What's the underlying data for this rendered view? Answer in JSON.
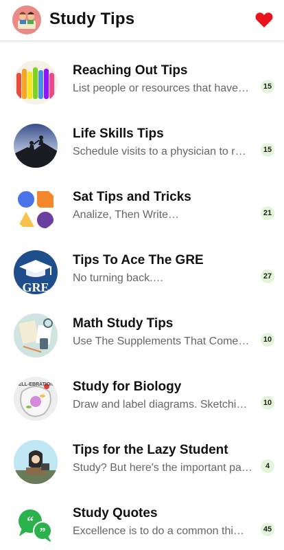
{
  "app": {
    "title": "Study Tips",
    "logo_icon": "kids-reading-icon",
    "favorite_icon": "heart-icon",
    "heart_color": "#e8131b"
  },
  "colors": {
    "badge_bg": "#e2f5d8",
    "subtitle": "#666666"
  },
  "items": [
    {
      "title": "Reaching Out Tips",
      "subtitle": "List people or resources that have…",
      "count": "15",
      "icon": "raised-hands-icon"
    },
    {
      "title": "Life Skills Tips",
      "subtitle": "Schedule visits to a physician to r…",
      "count": "15",
      "icon": "mountain-climbers-icon"
    },
    {
      "title": "Sat Tips and Tricks",
      "subtitle": "Analize, Then Write…",
      "count": "21",
      "icon": "colorful-shapes-icon"
    },
    {
      "title": "Tips To Ace The GRE",
      "subtitle": "No turning back.…",
      "count": "27",
      "icon": "gre-graduation-cap-icon"
    },
    {
      "title": "Math Study Tips",
      "subtitle": "Use The Supplements That Come…",
      "count": "10",
      "icon": "math-desk-icon"
    },
    {
      "title": "Study for Biology",
      "subtitle": "Draw and label diagrams. Sketchi…",
      "count": "10",
      "icon": "cell-biology-icon"
    },
    {
      "title": "Tips for the Lazy Student",
      "subtitle": "Study? But here's the important pa…",
      "count": "4",
      "icon": "sleepy-student-icon"
    },
    {
      "title": "Study Quotes",
      "subtitle": "Excellence is to do a common thi…",
      "count": "45",
      "icon": "quote-bubble-icon"
    }
  ]
}
